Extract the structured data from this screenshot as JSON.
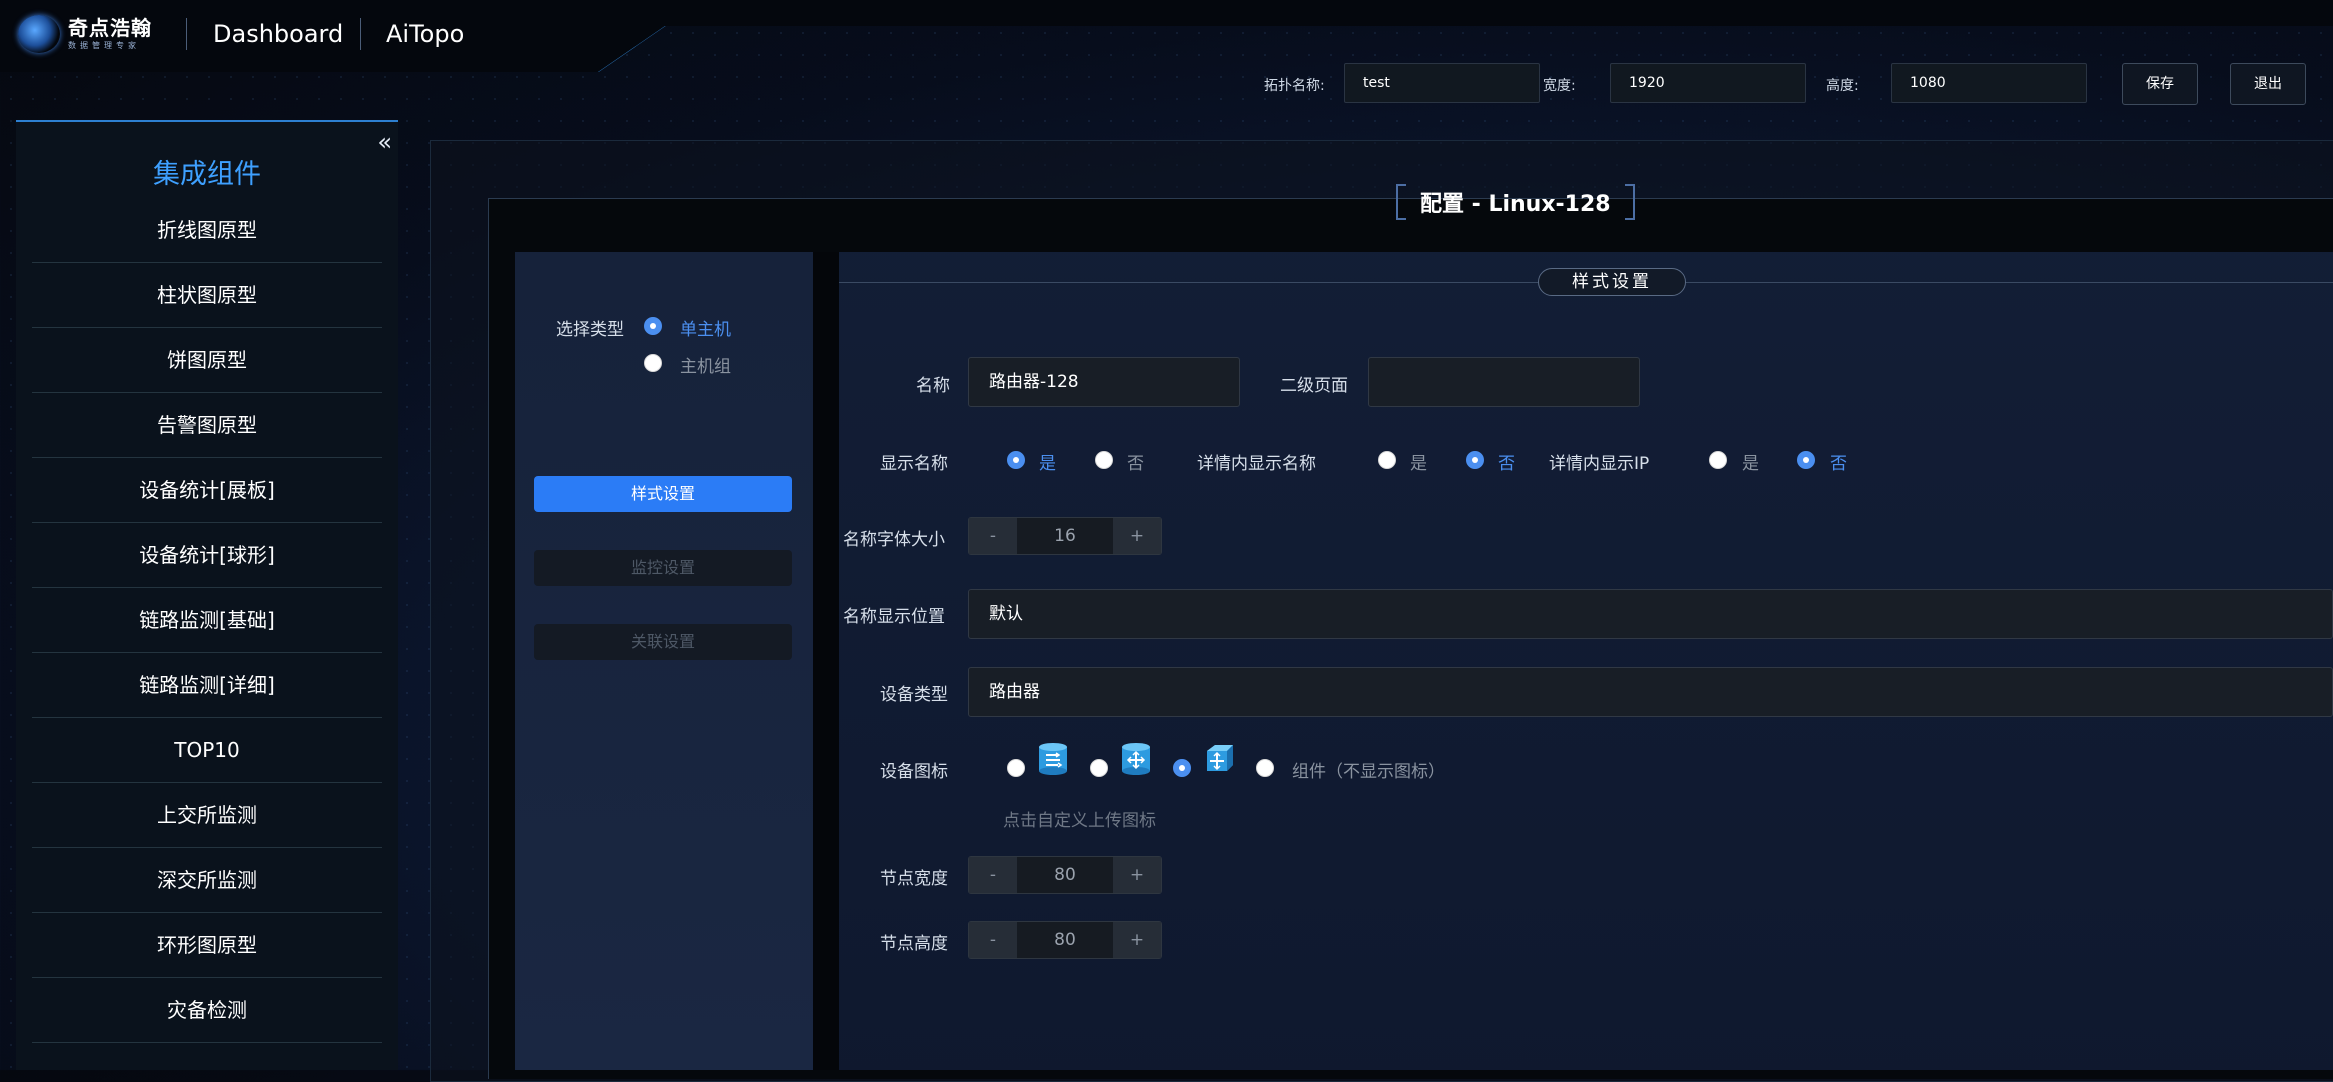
{
  "header": {
    "logo_main": "奇点浩翰",
    "logo_sub": "数据管理专家",
    "nav": [
      "Dashboard",
      "AiTopo"
    ],
    "topo_name_label": "拓扑名称:",
    "topo_name_value": "test",
    "width_label": "宽度:",
    "width_value": "1920",
    "height_label": "高度:",
    "height_value": "1080",
    "save_label": "保存",
    "exit_label": "退出",
    "accent_color": "#2f86d6"
  },
  "sidebar": {
    "collapse_icon": "double-chevron-left",
    "title": "集成组件",
    "items": [
      "折线图原型",
      "柱状图原型",
      "饼图原型",
      "告警图原型",
      "设备统计[展板]",
      "设备统计[球形]",
      "链路监测[基础]",
      "链路监测[详细]",
      "TOP10",
      "上交所监测",
      "深交所监测",
      "环形图原型",
      "灾备检测"
    ]
  },
  "dialog": {
    "title": "配置 - Linux-128",
    "select_type_label": "选择类型",
    "type_options": [
      {
        "label": "单主机",
        "selected": true
      },
      {
        "label": "主机组",
        "selected": false
      }
    ],
    "tabs": [
      {
        "label": "样式设置",
        "active": true
      },
      {
        "label": "监控设置",
        "active": false
      },
      {
        "label": "关联设置",
        "active": false
      }
    ]
  },
  "style_settings": {
    "section_title": "样式设置",
    "name_label": "名称",
    "name_value": "路由器-128",
    "sub_page_label": "二级页面",
    "sub_page_value": "",
    "show_name_label": "显示名称",
    "show_name": {
      "yes": "是",
      "no": "否",
      "selected": "yes"
    },
    "detail_show_name_label": "详情内显示名称",
    "detail_show_name": {
      "yes": "是",
      "no": "否",
      "selected": "no"
    },
    "detail_show_ip_label": "详情内显示IP",
    "detail_show_ip": {
      "yes": "是",
      "no": "否",
      "selected": "no"
    },
    "font_size_label": "名称字体大小",
    "font_size_value": "16",
    "name_position_label": "名称显示位置",
    "name_position_value": "默认",
    "device_type_label": "设备类型",
    "device_type_value": "路由器",
    "device_icon_label": "设备图标",
    "device_icons": [
      "router-cylinder-icon",
      "switch-cylinder-icon",
      "switch-cube-icon"
    ],
    "device_icon_selected": 2,
    "component_option": "组件（不显示图标）",
    "upload_hint": "点击自定义上传图标",
    "node_width_label": "节点宽度",
    "node_width_value": "80",
    "node_height_label": "节点高度",
    "node_height_value": "80",
    "stepper_minus": "-",
    "stepper_plus": "+",
    "accent_color": "#4b8ff0"
  }
}
